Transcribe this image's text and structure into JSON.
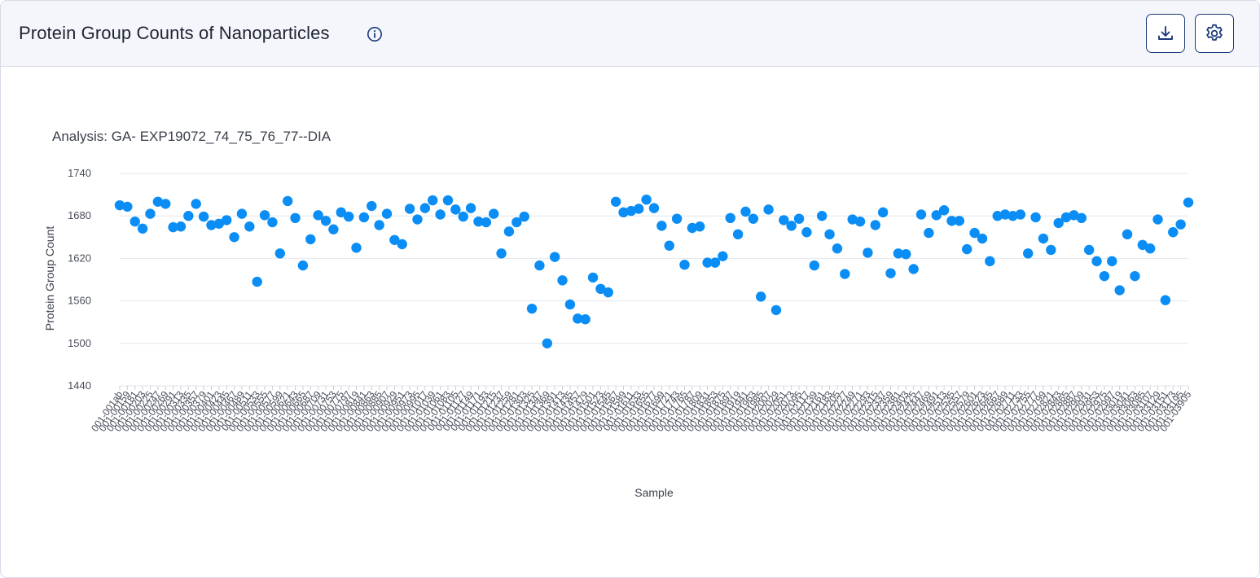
{
  "header": {
    "title": "Protein Group Counts of Nanoparticles",
    "info_icon": "info-circle-icon",
    "download_icon": "download-icon",
    "settings_icon": "gear-icon"
  },
  "colors": {
    "point": "#0a8ef5",
    "grid": "#e3e6ee",
    "header_bg": "#f4f6fb",
    "button_border": "#1b3a7a"
  },
  "chart_data": {
    "type": "scatter",
    "subtitle": "Analysis: GA- EXP19072_74_75_76_77--DIA",
    "xlabel": "Sample",
    "ylabel": "Protein Group Count",
    "ylim": [
      1440,
      1740
    ],
    "yticks": [
      1440,
      1500,
      1560,
      1620,
      1680,
      1740
    ],
    "grid": true,
    "legend": "none",
    "x_tick_labels": [
      "001-001ab",
      "001-00159",
      "001-00181",
      "001-00203",
      "001-00225",
      "001-00247",
      "001-00269",
      "001-00291",
      "001-00313",
      "001-00335",
      "001-00357",
      "001-00379",
      "001-00401",
      "001-00423",
      "001-00445",
      "001-00467",
      "001-00489",
      "001-00511",
      "001-00533",
      "001-00555",
      "001-00577",
      "001-00599",
      "001-00621",
      "001-00643",
      "001-00665",
      "001-00687",
      "001-00709",
      "001-00731",
      "001-00753",
      "001-00775",
      "001-00797",
      "001-00819",
      "001-00841",
      "001-00863",
      "001-00885",
      "001-00907",
      "001-00929",
      "001-00951",
      "001-00973",
      "001-00995",
      "001-01017",
      "001-01039",
      "001-01061",
      "001-01083",
      "001-01105",
      "001-01127",
      "001-01149",
      "001-01171",
      "001-01193",
      "001-01215",
      "001-01237",
      "001-01259",
      "001-01281",
      "001-01303",
      "001-01325",
      "001-01347",
      "001-01369",
      "001-01391",
      "001-01413",
      "001-01435",
      "001-01457",
      "001-01479",
      "001-01501",
      "001-01523",
      "001-01545",
      "001-01567",
      "001-01589",
      "001-01611",
      "001-01633",
      "001-01655",
      "001-01677",
      "001-01699",
      "001-01721",
      "001-01743",
      "001-01765",
      "001-01787",
      "001-01809",
      "001-01831",
      "001-01853",
      "001-01875",
      "001-01897",
      "001-01919",
      "001-01941",
      "001-01963",
      "001-01985",
      "001-02007",
      "001-02029",
      "001-02051",
      "001-02073",
      "001-02095",
      "001-02117",
      "001-02139",
      "001-02161",
      "001-02183",
      "001-02205",
      "001-02227",
      "001-02249",
      "001-02271",
      "001-02293",
      "001-02315",
      "001-02337",
      "001-02359",
      "001-02381",
      "001-02403",
      "001-02425",
      "001-02447",
      "001-02469",
      "001-02491",
      "001-02513",
      "001-02535",
      "001-02557",
      "001-02579",
      "001-02601",
      "001-02623",
      "001-02645",
      "001-02667",
      "001-02689",
      "001-02711",
      "001-02733",
      "001-02755",
      "001-02777",
      "001-02799",
      "001-02821",
      "001-02843",
      "001-02865",
      "001-02887",
      "001-02909",
      "001-02931",
      "001-02953",
      "001-02975",
      "001-02997",
      "001-03019",
      "001-03041",
      "001-03063",
      "001-03085",
      "001-03107",
      "001-03129",
      "001-03151",
      "001-03173",
      "001-03195",
      "001-03905"
    ],
    "values": [
      1695,
      1693,
      1672,
      1662,
      1683,
      1700,
      1697,
      1664,
      1665,
      1680,
      1697,
      1679,
      1667,
      1669,
      1674,
      1650,
      1683,
      1665,
      1587,
      1681,
      1671,
      1627,
      1701,
      1677,
      1610,
      1647,
      1681,
      1673,
      1661,
      1685,
      1679,
      1635,
      1678,
      1694,
      1667,
      1683,
      1646,
      1640,
      1690,
      1675,
      1691,
      1702,
      1682,
      1702,
      1689,
      1679,
      1691,
      1672,
      1671,
      1683,
      1627,
      1658,
      1671,
      1679,
      1549,
      1610,
      1500,
      1622,
      1589,
      1555,
      1535,
      1534,
      1593,
      1577,
      1572,
      1700,
      1685,
      1687,
      1690,
      1703,
      1691,
      1666,
      1638,
      1676,
      1611,
      1663,
      1665,
      1614,
      1614,
      1623,
      1677,
      1654,
      1686,
      1676,
      1566,
      1689,
      1547,
      1674,
      1666,
      1676,
      1657,
      1610,
      1680,
      1654,
      1634,
      1598,
      1675,
      1672,
      1628,
      1667,
      1685,
      1599,
      1627,
      1626,
      1605,
      1682,
      1656,
      1681,
      1688,
      1673,
      1673,
      1633,
      1656,
      1648,
      1616,
      1680,
      1682,
      1680,
      1682,
      1627,
      1678,
      1648,
      1632,
      1670,
      1678,
      1681,
      1677,
      1632,
      1616,
      1595,
      1616,
      1575,
      1654,
      1595,
      1639,
      1634,
      1675,
      1561,
      1657,
      1668,
      1699
    ]
  }
}
